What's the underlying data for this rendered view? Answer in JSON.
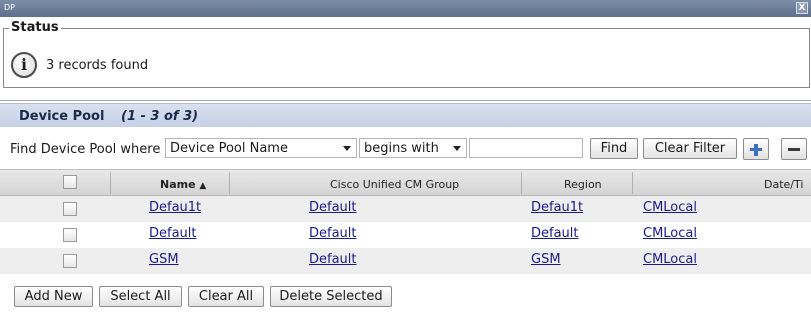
{
  "window": {
    "title": "DP",
    "close_glyph": "X"
  },
  "status": {
    "legend": "Status",
    "icon": "info-icon",
    "icon_glyph": "i",
    "message": "3 records found"
  },
  "section": {
    "title": "Device Pool",
    "range": "(1 - 3 of 3)"
  },
  "filter": {
    "label": "Find Device Pool where",
    "field_value": "Device Pool Name",
    "operator_value": "begins with",
    "search_value": "",
    "find_label": "Find",
    "clear_filter_label": "Clear Filter",
    "add_icon": "plus-icon",
    "remove_icon": "minus-icon"
  },
  "table": {
    "columns": [
      "Name",
      "Cisco Unified CM Group",
      "Region",
      "Date/Ti"
    ],
    "sort_indicator": "▲",
    "rows": [
      {
        "name": "Defau1t",
        "cm_group": "Default",
        "region": "Defau1t",
        "datetime": "CMLocal"
      },
      {
        "name": "Default",
        "cm_group": "Default",
        "region": "Default",
        "datetime": "CMLocal"
      },
      {
        "name": "GSM",
        "cm_group": "Default",
        "region": "GSM",
        "datetime": "CMLocal"
      }
    ]
  },
  "buttons": {
    "add_new": "Add New",
    "select_all": "Select All",
    "clear_all": "Clear All",
    "delete_selected": "Delete Selected"
  }
}
